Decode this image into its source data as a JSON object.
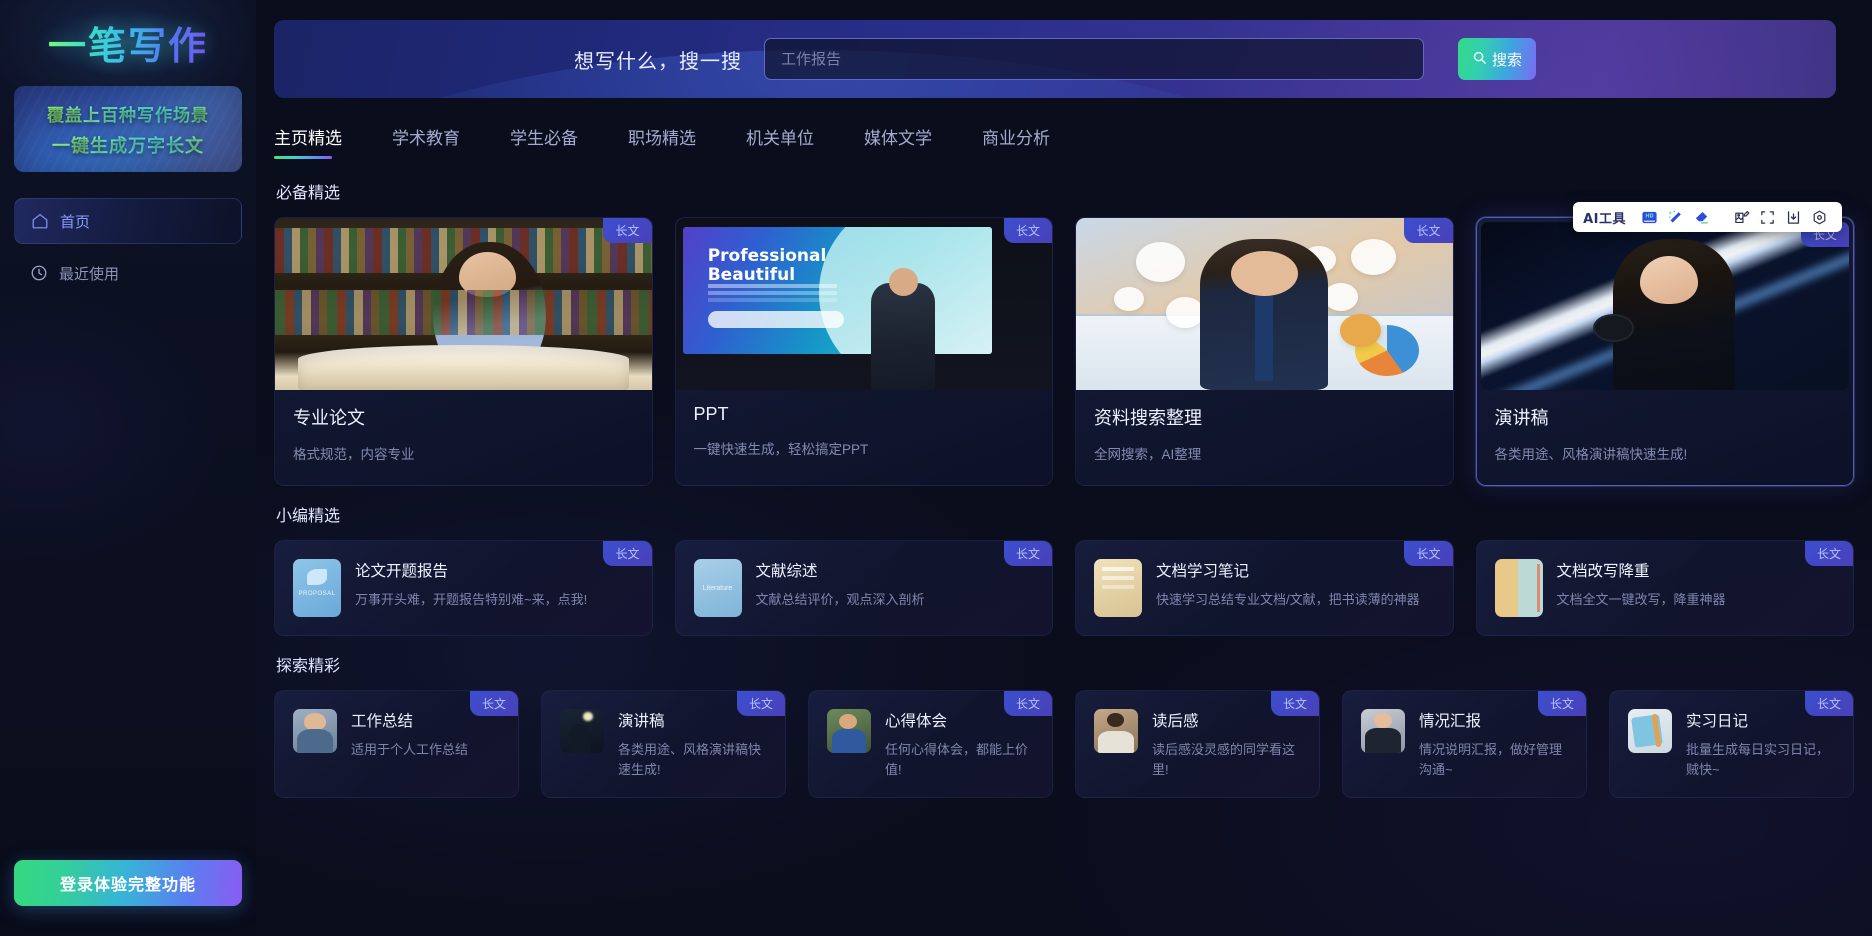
{
  "sidebar": {
    "logo": "一笔写作",
    "promo": {
      "line1": "覆盖上百种写作场景",
      "line2": "一键生成万字长文"
    },
    "nav": [
      {
        "label": "首页",
        "icon": "home-icon",
        "active": true
      },
      {
        "label": "最近使用",
        "icon": "clock-icon",
        "active": false
      }
    ],
    "login_label": "登录体验完整功能"
  },
  "banner": {
    "label": "想写什么，搜一搜",
    "search_placeholder": "工作报告",
    "search_value": "",
    "search_button": "搜索"
  },
  "tabs": [
    {
      "label": "主页精选",
      "active": true
    },
    {
      "label": "学术教育",
      "active": false
    },
    {
      "label": "学生必备",
      "active": false
    },
    {
      "label": "职场精选",
      "active": false
    },
    {
      "label": "机关单位",
      "active": false
    },
    {
      "label": "媒体文学",
      "active": false
    },
    {
      "label": "商业分析",
      "active": false
    }
  ],
  "ai_toolbar": {
    "label": "AI工具",
    "tools": [
      {
        "name": "hd-icon"
      },
      {
        "name": "magic-wand-icon"
      },
      {
        "name": "eraser-icon"
      },
      {
        "name": "image-edit-icon"
      },
      {
        "name": "crop-icon"
      },
      {
        "name": "download-icon"
      },
      {
        "name": "settings-icon"
      }
    ]
  },
  "sections": [
    {
      "title": "必备精选",
      "type": "feature",
      "cards": [
        {
          "title": "专业论文",
          "desc": "格式规范，内容专业",
          "badge": "长文",
          "thumb": "library-photo",
          "selected": false
        },
        {
          "title": "PPT",
          "desc": "一键快速生成，轻松搞定PPT",
          "badge": "长文",
          "thumb": "ppt-photo",
          "selected": false
        },
        {
          "title": "资料搜索整理",
          "desc": "全网搜索，AI整理",
          "badge": "长文",
          "thumb": "data-photo",
          "selected": false
        },
        {
          "title": "演讲稿",
          "desc": "各类用途、风格演讲稿快速生成!",
          "badge": "长文",
          "thumb": "stage-photo",
          "selected": true
        }
      ]
    },
    {
      "title": "小编精选",
      "type": "small",
      "cards": [
        {
          "title": "论文开题报告",
          "desc": "万事开头难，开题报告特别难~来，点我!",
          "badge": "长文",
          "thumb": "proposal-thumb"
        },
        {
          "title": "文献综述",
          "desc": "文献总结评价，观点深入剖析",
          "badge": "长文",
          "thumb": "literature-thumb"
        },
        {
          "title": "文档学习笔记",
          "desc": "快速学习总结专业文档/文献，把书读薄的神器",
          "badge": "长文",
          "thumb": "note-thumb"
        },
        {
          "title": "文档改写降重",
          "desc": "文档全文一键改写，降重神器",
          "badge": "长文",
          "thumb": "rewrite-thumb"
        }
      ]
    },
    {
      "title": "探索精彩",
      "type": "small6",
      "cards": [
        {
          "title": "工作总结",
          "desc": "适用于个人工作总结",
          "badge": "长文",
          "thumb": "work-thumb"
        },
        {
          "title": "演讲稿",
          "desc": "各类用途、风格演讲稿快速生成!",
          "badge": "长文",
          "thumb": "speech-thumb"
        },
        {
          "title": "心得体会",
          "desc": "任何心得体会，都能上价值!",
          "badge": "长文",
          "thumb": "insight-thumb"
        },
        {
          "title": "读后感",
          "desc": "读后感没灵感的同学看这里!",
          "badge": "长文",
          "thumb": "read-thumb"
        },
        {
          "title": "情况汇报",
          "desc": "情况说明汇报，做好管理沟通~",
          "badge": "长文",
          "thumb": "report-thumb"
        },
        {
          "title": "实习日记",
          "desc": "批量生成每日实习日记，贼快~",
          "badge": "长文",
          "thumb": "diary-thumb"
        }
      ]
    }
  ],
  "colors": {
    "accent_green": "#35d97e",
    "accent_blue": "#3ba8dd",
    "accent_purple": "#7a6cf2",
    "badge_bg": "#3b4fcf",
    "page_bg": "#0a0d1c"
  }
}
